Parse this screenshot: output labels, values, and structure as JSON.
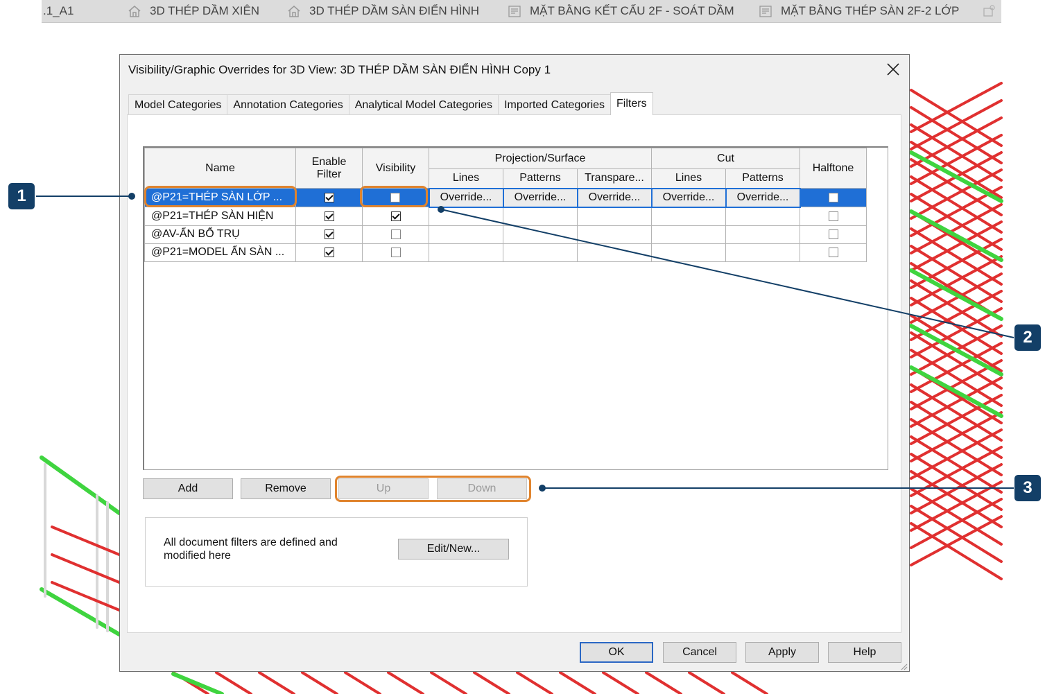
{
  "view_tabs": [
    {
      "label": ".1_A1",
      "icon": "none"
    },
    {
      "label": "3D THÉP DẦM XIÊN",
      "icon": "house-icon"
    },
    {
      "label": "3D THÉP DẦM SÀN ĐIỂN HÌNH",
      "icon": "house-icon"
    },
    {
      "label": "MẶT BẰNG KẾT CẤU 2F - SOÁT DẦM",
      "icon": "plan-icon"
    },
    {
      "label": "MẶT BẰNG THÉP SÀN 2F-2 LỚP",
      "icon": "plan-icon"
    }
  ],
  "dialog": {
    "title": "Visibility/Graphic Overrides for 3D View: 3D THÉP DẦM SÀN ĐIỂN HÌNH Copy 1",
    "tabs": [
      "Model Categories",
      "Annotation Categories",
      "Analytical Model Categories",
      "Imported Categories",
      "Filters"
    ],
    "active_tab": "Filters",
    "table": {
      "headers": {
        "name": "Name",
        "enable_filter_line1": "Enable",
        "enable_filter_line2": "Filter",
        "visibility": "Visibility",
        "projection_surface": "Projection/Surface",
        "proj_lines": "Lines",
        "proj_patterns": "Patterns",
        "proj_transparency": "Transpare...",
        "cut": "Cut",
        "cut_lines": "Lines",
        "cut_patterns": "Patterns",
        "halftone": "Halftone"
      },
      "override_label": "Override...",
      "rows": [
        {
          "name": "@P21=THÉP SÀN LỚP ...",
          "enable_filter": true,
          "visibility": false,
          "halftone": false,
          "selected": true
        },
        {
          "name": "@P21=THÉP SÀN HIỆN",
          "enable_filter": true,
          "visibility": true,
          "halftone": false,
          "selected": false
        },
        {
          "name": "@AV-ẨN BỔ TRỤ",
          "enable_filter": true,
          "visibility": false,
          "halftone": false,
          "selected": false
        },
        {
          "name": "@P21=MODEL ẨN SÀN ...",
          "enable_filter": true,
          "visibility": false,
          "halftone": false,
          "selected": false
        }
      ]
    },
    "buttons": {
      "add": "Add",
      "remove": "Remove",
      "up": "Up",
      "down": "Down",
      "edit_new": "Edit/New...",
      "ok": "OK",
      "cancel": "Cancel",
      "apply": "Apply",
      "help": "Help"
    },
    "info_text": "All document filters are defined and modified here"
  },
  "callouts": [
    "1",
    "2",
    "3"
  ],
  "colors": {
    "highlight": "#e0842e",
    "badge": "#133f67",
    "selection": "#1f6fd6",
    "rebar_red": "#e03030",
    "rebar_green": "#3fd43f"
  }
}
